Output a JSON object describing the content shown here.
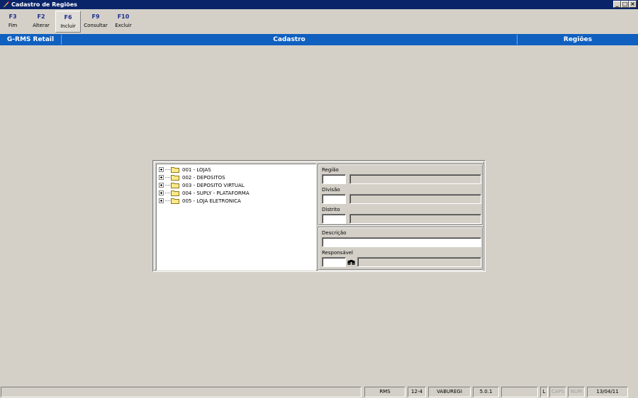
{
  "window": {
    "title": "Cadastro de Regiões",
    "controls": [
      "_",
      "□",
      "×"
    ]
  },
  "toolbar": [
    {
      "key": "F3",
      "label": "Fim"
    },
    {
      "key": "F2",
      "label": "Alterar"
    },
    {
      "key": "F6",
      "label": "Incluir"
    },
    {
      "key": "F9",
      "label": "Consultar"
    },
    {
      "key": "F10",
      "label": "Excluir"
    }
  ],
  "header": {
    "left": "G-RMS Retail",
    "center": "Cadastro",
    "right": "Regiões"
  },
  "tree": {
    "items": [
      "001 - LOJAS",
      "002 - DEPOSITOS",
      "003 - DEPOSITO VIRTUAL",
      "004 - SUPLY - PLATAFORMA",
      "005 - LOJA ELETRONICA"
    ]
  },
  "form": {
    "regiao_label": "Região",
    "divisao_label": "Divisão",
    "distrito_label": "Distrito",
    "descricao_label": "Descrição",
    "responsavel_label": "Responsável"
  },
  "statusbar": {
    "app": "RMS",
    "code": "12-4",
    "program": "VABUREGI",
    "version": "5.0.1",
    "l": "L",
    "caps": "CAPS",
    "num": "NUM",
    "date": "13/04/11"
  },
  "colors": {
    "title_bar": "#0a246a",
    "header_band": "#1060c0",
    "toolbar_key": "#1f2e8c",
    "background": "#d4d0c8"
  }
}
